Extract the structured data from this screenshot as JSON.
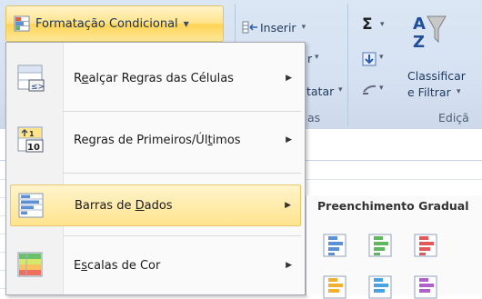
{
  "ribbon": {
    "conditional_formatting_label": "Formatação Condicional",
    "insert_label": "Inserir",
    "insert_arrow": "▾",
    "partial_r": "r",
    "partial_tatar": "tatar",
    "partial_as": "as",
    "sigma_glyph": "Σ",
    "sort_filter_line1": "Classificar",
    "sort_filter_line2": "e Filtrar",
    "edit_group_label": "Ediçã"
  },
  "menu": {
    "items": [
      {
        "label_before": "R",
        "label_mnemonic": "e",
        "label_after": "alçar Regras das Células",
        "icon": "highlight-cells-rules-icon"
      },
      {
        "label_before": "Regras de Primeiros/Úl",
        "label_mnemonic": "t",
        "label_after": "imos",
        "icon": "top-bottom-rules-icon"
      },
      {
        "label_before": "Barras de ",
        "label_mnemonic": "D",
        "label_after": "ados",
        "icon": "data-bars-icon"
      },
      {
        "label_before": "E",
        "label_mnemonic": "s",
        "label_after": "calas de Cor",
        "icon": "color-scales-icon"
      }
    ],
    "highlighted_index": 2
  },
  "submenu": {
    "title": "Preenchimento Gradual",
    "tiles": [
      {
        "color": "#5b8fd6",
        "icon": "blue-data-bar-icon"
      },
      {
        "color": "#5fb85f",
        "icon": "green-data-bar-icon"
      },
      {
        "color": "#e05a5a",
        "icon": "red-data-bar-icon"
      },
      {
        "color": "#f0b030",
        "icon": "orange-data-bar-icon"
      },
      {
        "color": "#4aa3e0",
        "icon": "lightblue-data-bar-icon"
      },
      {
        "color": "#b060c8",
        "icon": "purple-data-bar-icon"
      }
    ]
  },
  "colors": {
    "highlight": "#ffe38e",
    "ribbon_bg": "#dbe6f4"
  }
}
